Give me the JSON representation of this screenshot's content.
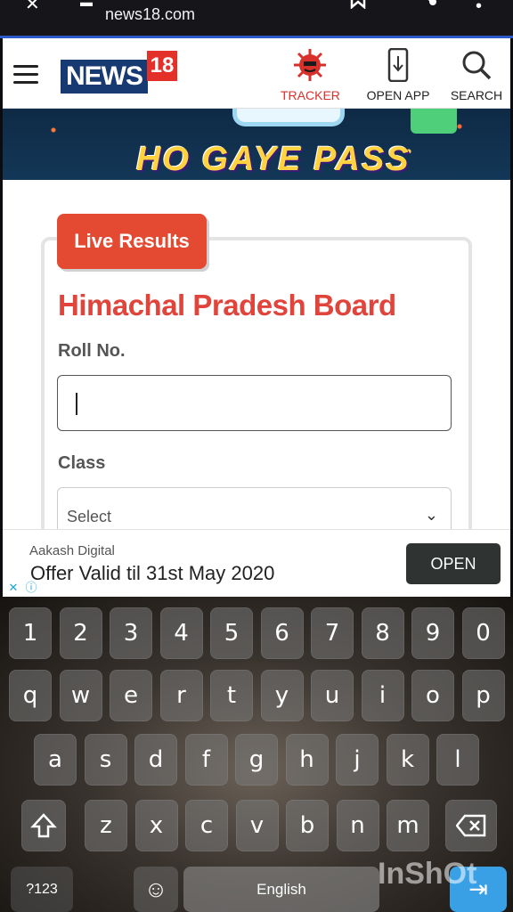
{
  "status_bar": {
    "url": "news18.com",
    "icons": [
      "close-icon",
      "tab-icon",
      "bookmark-icon",
      "share-icon",
      "more-icon"
    ]
  },
  "header": {
    "logo_text": "NEWS",
    "logo_number": "18",
    "items": [
      {
        "label": "TRACKER",
        "icon": "virus-icon"
      },
      {
        "label": "OPEN APP",
        "icon": "phone-download-icon"
      },
      {
        "label": "SEARCH",
        "icon": "search-icon"
      }
    ]
  },
  "banner": {
    "title": "HO GAYE PASS"
  },
  "form": {
    "badge": "Live Results",
    "title": "Himachal Pradesh Board",
    "roll_label": "Roll No.",
    "roll_value": "",
    "class_label": "Class",
    "class_value": "Select"
  },
  "ad": {
    "sponsor": "Aakash Digital",
    "headline": "Offer Valid til 31st May 2020",
    "cta": "OPEN"
  },
  "keyboard": {
    "row_numbers": [
      "1",
      "2",
      "3",
      "4",
      "5",
      "6",
      "7",
      "8",
      "9",
      "0"
    ],
    "row_top": [
      "q",
      "w",
      "e",
      "r",
      "t",
      "y",
      "u",
      "i",
      "o",
      "p"
    ],
    "row_mid": [
      "a",
      "s",
      "d",
      "f",
      "g",
      "h",
      "j",
      "k",
      "l"
    ],
    "row_bottom": [
      "z",
      "x",
      "c",
      "v",
      "b",
      "n",
      "m"
    ],
    "symbols_label": "?123",
    "space_label": "English",
    "watermark": "InShOt"
  }
}
